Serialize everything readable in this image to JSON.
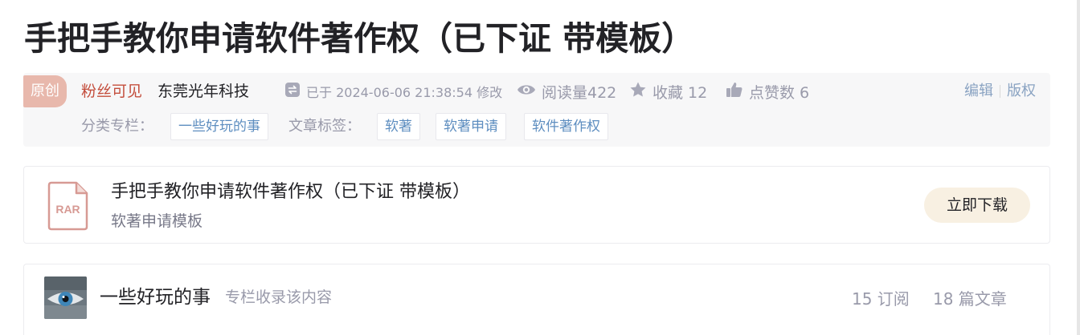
{
  "article": {
    "title": "手把手教你申请软件著作权（已下证 带模板）"
  },
  "meta": {
    "original_badge": "原创",
    "fans_only": "粉丝可见",
    "author": "东莞光年科技",
    "modified": "已于 2024-06-06 21:38:54 修改",
    "views": "阅读量422",
    "favorites": "收藏 12",
    "likes": "点赞数 6",
    "edit_link": "编辑",
    "copyright_link": "版权",
    "category_label": "分类专栏：",
    "category": "一些好玩的事",
    "tags_label": "文章标签：",
    "tags": [
      "软著",
      "软著申请",
      "软件著作权"
    ]
  },
  "download": {
    "file_type": "RAR",
    "title": "手把手教你申请软件著作权（已下证 带模板）",
    "subtitle": "软著申请模板",
    "button": "立即下载"
  },
  "column": {
    "name": "一些好玩的事",
    "note": "专栏收录该内容",
    "subscriptions": "15 订阅",
    "articles": "18 篇文章"
  },
  "colors": {
    "accent_red": "#c44e3d",
    "badge": "#e8b8ac",
    "link_blue": "#5e8ec0",
    "download_button": "#f8f0e2"
  },
  "icons": [
    "refresh-icon",
    "eye-icon",
    "star-icon",
    "thumbs-up-icon",
    "rar-file-icon"
  ]
}
